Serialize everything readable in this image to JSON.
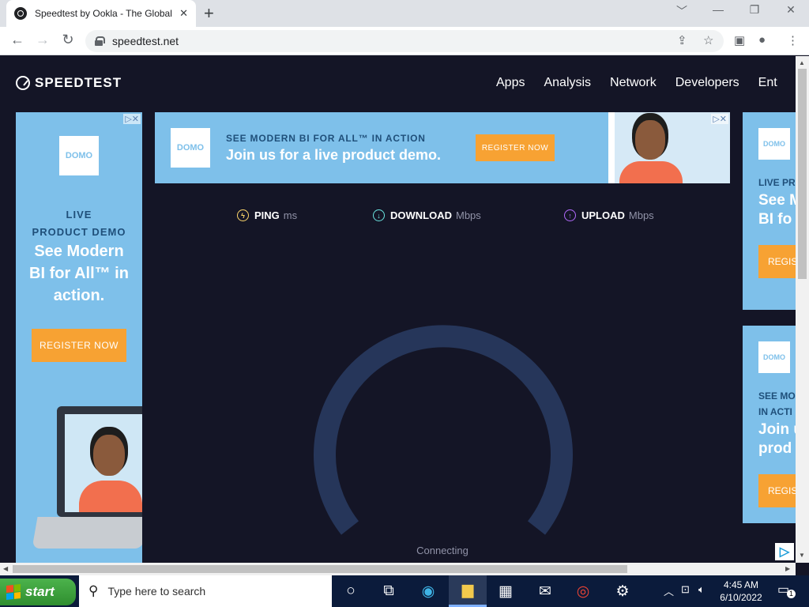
{
  "browser": {
    "tab_title": "Speedtest by Ookla - The Global",
    "tab_close": "✕",
    "new_tab": "+",
    "url": "speedtest.net",
    "window_controls": [
      "﹀",
      "—",
      "❐",
      "✕"
    ]
  },
  "site": {
    "logo_text": "SPEEDTEST",
    "nav": [
      "Apps",
      "Analysis",
      "Network",
      "Developers",
      "Ent"
    ]
  },
  "ads": {
    "brand": "DOMO",
    "left": {
      "line1": "LIVE",
      "line2": "PRODUCT DEMO",
      "headline": "See Modern BI for All™ in action.",
      "cta": "REGISTER NOW"
    },
    "top": {
      "line1": "SEE MODERN BI FOR ALL™ IN ACTION",
      "line2": "Join us for a live product demo.",
      "cta": "REGISTER NOW"
    },
    "right1": {
      "line1": "LIVE PR",
      "line2": "See M",
      "line3": "BI fo",
      "cta": "REGIS"
    },
    "right2": {
      "line1": "SEE MO",
      "line1b": "IN ACTI",
      "line2": "Join u",
      "line3": "prod",
      "cta": "REGIS"
    },
    "adchoice": "▷✕"
  },
  "speedtest": {
    "metrics": [
      {
        "name": "PING",
        "unit": "ms",
        "color": "#ffd86b",
        "icon": "bolt-icon"
      },
      {
        "name": "DOWNLOAD",
        "unit": "Mbps",
        "color": "#6be6e2",
        "icon": "arrow-down-icon"
      },
      {
        "name": "UPLOAD",
        "unit": "Mbps",
        "color": "#b36bff",
        "icon": "arrow-up-icon"
      }
    ],
    "status": "Connecting"
  },
  "taskbar": {
    "start_label": "start",
    "search_placeholder": "Type here to search",
    "time": "4:45 AM",
    "date": "6/10/2022",
    "notification_count": "1"
  }
}
